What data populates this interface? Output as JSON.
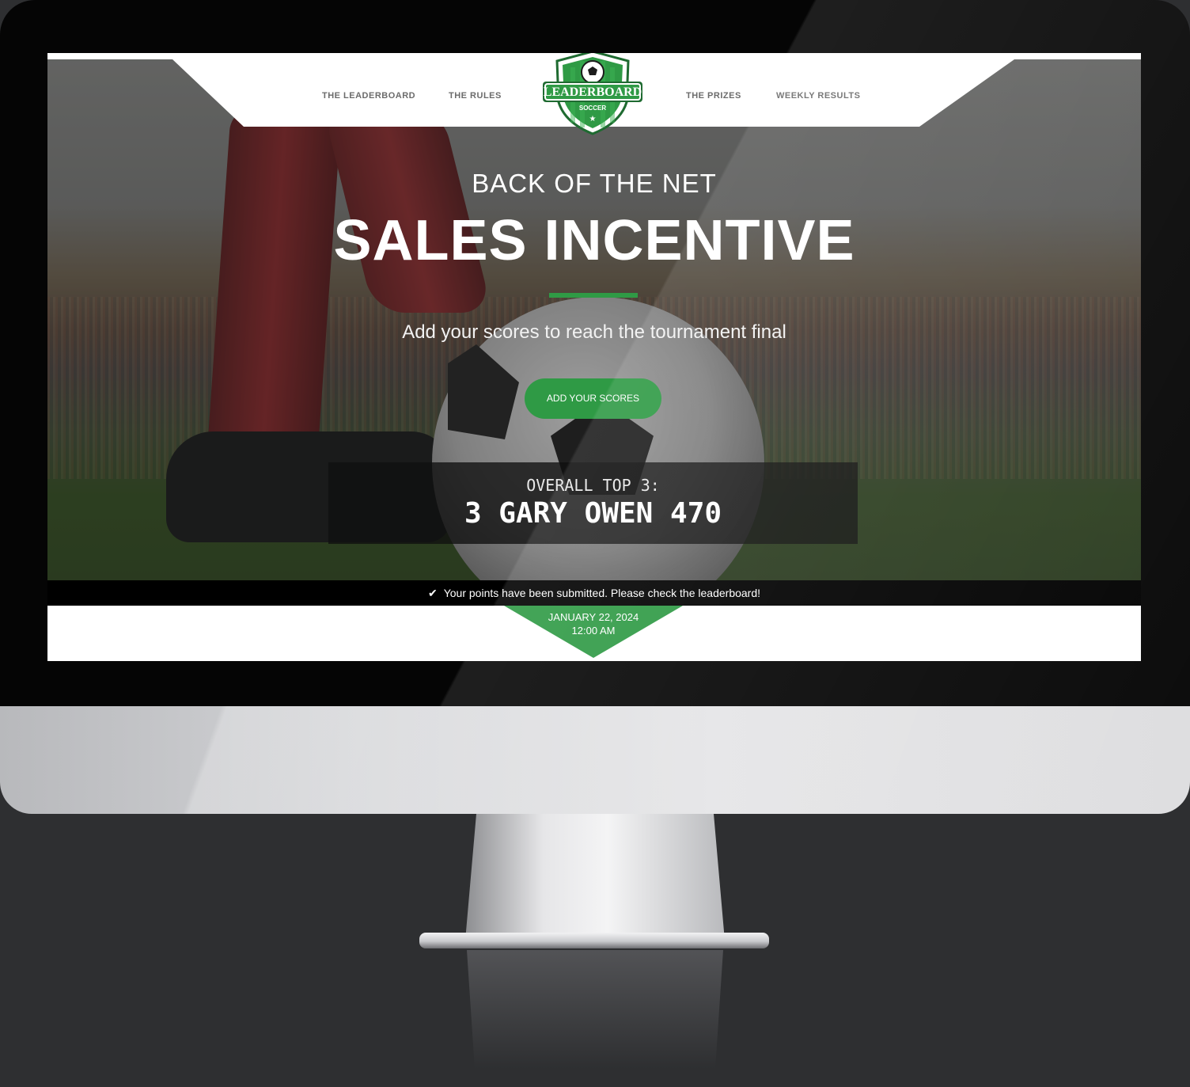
{
  "nav": {
    "items": [
      {
        "label": "THE LEADERBOARD"
      },
      {
        "label": "THE RULES"
      },
      {
        "label": "THE PRIZES"
      },
      {
        "label": "WEEKLY RESULTS"
      }
    ],
    "logo": {
      "title": "LEADERBOARD",
      "subtitle": "SOCCER"
    }
  },
  "hero": {
    "eyebrow": "BACK OF THE NET",
    "headline": "SALES INCENTIVE",
    "subtitle": "Add your scores to reach the tournament final",
    "cta_label": "ADD YOUR SCORES"
  },
  "scoreboard": {
    "title": "OVERALL TOP 3:",
    "entry": "3 GARY OWEN 470"
  },
  "notice": {
    "icon": "check-icon",
    "text": "Your points have been submitted. Please check the leaderboard!"
  },
  "date_badge": {
    "date": "JANUARY 22, 2024",
    "time": "12:00 AM"
  },
  "colors": {
    "accent_green": "#2f9a45",
    "nav_text": "#6b6b6b"
  }
}
